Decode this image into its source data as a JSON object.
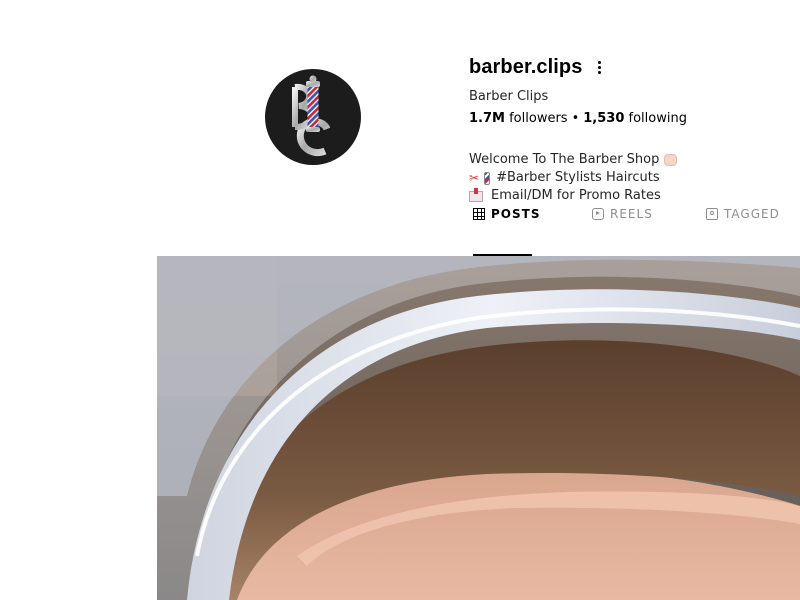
{
  "profile": {
    "username": "barber.clips",
    "full_name": "Barber Clips",
    "followers_count": "1.7M",
    "followers_label": "followers",
    "separator": "•",
    "following_count": "1,530",
    "following_label": "following",
    "avatar_icon": "barber-pole-monogram-logo"
  },
  "bio": {
    "line1": "Welcome To The Barber Shop",
    "line1_emoji": "fist-icon",
    "line2": "#Barber Stylists Haircuts",
    "line2_emojis": [
      "scissors-icon",
      "barber-pole-icon"
    ],
    "line3": "Email/DM for Promo Rates",
    "line3_emoji": "envelope-icon"
  },
  "tabs": [
    {
      "label": "POSTS",
      "icon": "grid-icon",
      "active": true
    },
    {
      "label": "REELS",
      "icon": "reels-icon",
      "active": false
    },
    {
      "label": "TAGGED",
      "icon": "tagged-icon",
      "active": false
    }
  ],
  "colors": {
    "text_primary": "#000000",
    "text_muted": "#8e8e8e",
    "avatar_bg": "#1c1c1c"
  }
}
